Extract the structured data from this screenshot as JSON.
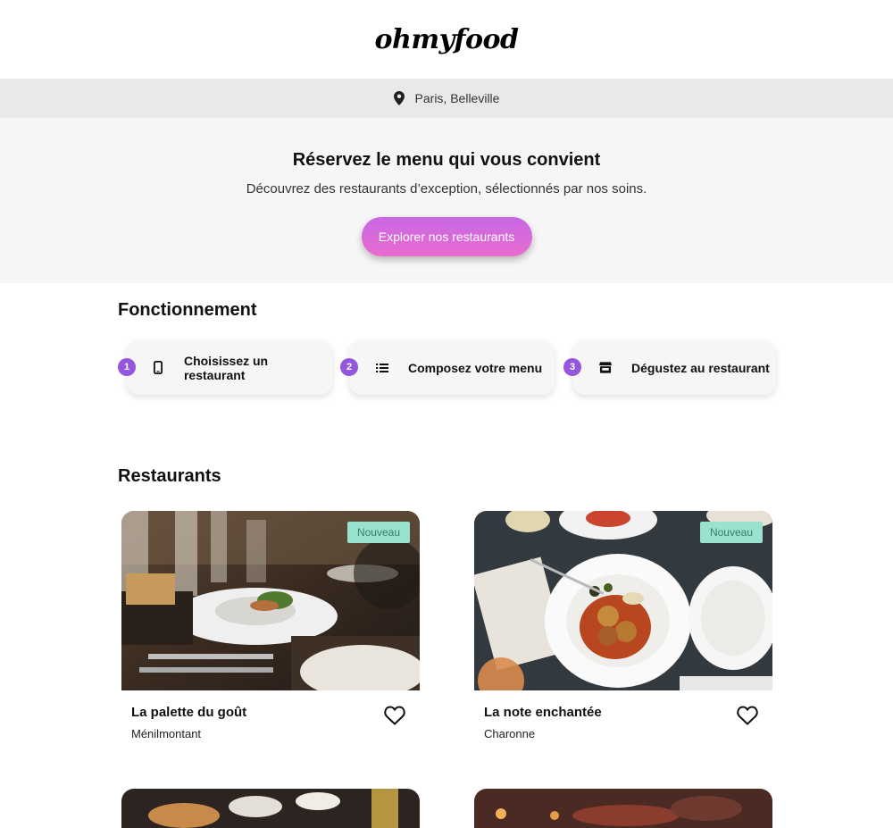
{
  "header": {
    "logo": "ohmyfood"
  },
  "location": {
    "icon": "map-pin-icon",
    "text": "Paris, Belleville"
  },
  "hero": {
    "title": "Réservez le menu qui vous convient",
    "subtitle": "Découvrez des restaurants d’exception, sélectionnés par nos soins.",
    "cta_label": "Explorer nos restaurants"
  },
  "how_it_works": {
    "title": "Fonctionnement",
    "steps": [
      {
        "number": "1",
        "icon": "mobile-phone-icon",
        "label": "Choisissez un restaurant"
      },
      {
        "number": "2",
        "icon": "list-icon",
        "label": "Composez votre menu"
      },
      {
        "number": "3",
        "icon": "store-icon",
        "label": "Dégustez au restaurant"
      }
    ]
  },
  "restaurants": {
    "title": "Restaurants",
    "items": [
      {
        "name": "La palette du goût",
        "area": "Ménilmontant",
        "badge": "Nouveau"
      },
      {
        "name": "La note enchantée",
        "area": "Charonne",
        "badge": "Nouveau"
      }
    ]
  },
  "colors": {
    "accent_purple": "#9356dc",
    "cta_gradient_start": "#c868e5",
    "cta_gradient_end": "#e96bcf",
    "badge_green": "#99e2d0"
  }
}
